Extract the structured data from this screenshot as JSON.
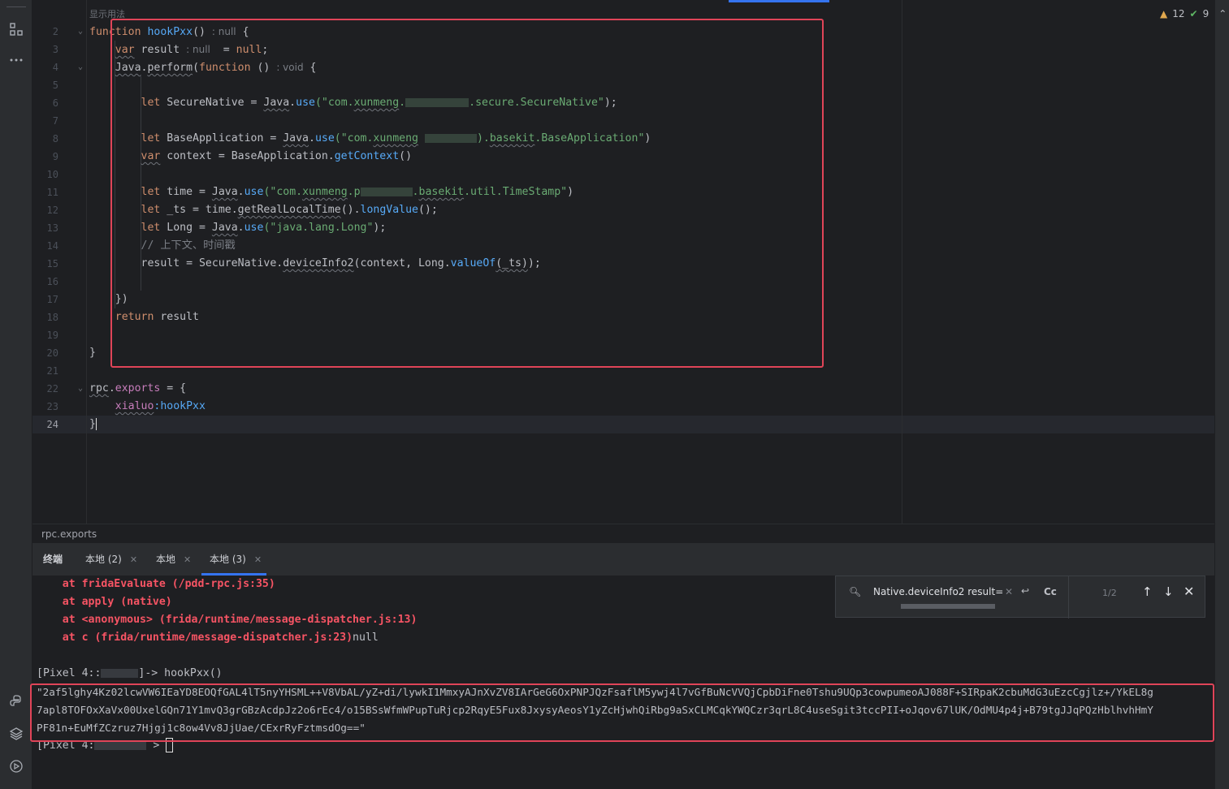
{
  "editor": {
    "hint_top": "显示用法",
    "inspections": {
      "warnings": "12",
      "ok": "9"
    },
    "line_numbers": [
      "2",
      "3",
      "4",
      "5",
      "6",
      "7",
      "8",
      "9",
      "10",
      "11",
      "12",
      "13",
      "14",
      "15",
      "16",
      "17",
      "18",
      "19",
      "20",
      "21",
      "22",
      "23",
      "24"
    ],
    "lines": {
      "l2": {
        "kw": "function",
        "name": "hookPxx",
        "punct": "()",
        "hint": ": null",
        "rest": " {"
      },
      "l3": {
        "kw": "var",
        "name": " result",
        "hint": ": null",
        "rest": "  = ",
        "null": "null",
        "end": ";"
      },
      "l4": {
        "obj": "Java",
        "dot": ".",
        "method": "perform",
        "open": "(",
        "kw": "function",
        "rest": " ()",
        "hint": ": void",
        "end": " {"
      },
      "l6": {
        "kw": "let",
        "rest": " SecureNative = ",
        "obj": "Java",
        "dot": ".",
        "method": "use",
        "str1": "(\"com.",
        "sq": "xunmeng",
        "str2": ".",
        "str3": ".secure.SecureNative\"",
        "end": ");"
      },
      "l8": {
        "kw": "let",
        "rest": " BaseApplication = ",
        "obj": "Java",
        "dot": ".",
        "method": "use",
        "str1": "(\"com.",
        "sq": "xunmeng",
        "str2": " ",
        "str3": ").",
        "sq2": "basekit",
        "str4": ".BaseApplication\"",
        "end": ")"
      },
      "l9": {
        "kw": "var",
        "rest": " context = BaseApplication.",
        "method": "getContext",
        "end": "()"
      },
      "l11": {
        "kw": "let",
        "rest": " time = ",
        "obj": "Java",
        "dot": ".",
        "method": "use",
        "str1": "(\"com.",
        "sq": "xunmeng",
        "str2": ".p",
        "str3": ".",
        "sq2": "basekit",
        "str4": ".util.TimeStamp\"",
        "end": ")"
      },
      "l12": {
        "kw": "let",
        "rest": " _ts = time.",
        "method": "getRealLocalTime",
        "mid": "().",
        "method2": "longValue",
        "end": "();"
      },
      "l13": {
        "kw": "let",
        "rest": " Long = ",
        "obj": "Java",
        "dot": ".",
        "method": "use",
        "str": "(\"java.lang.Long\"",
        "end": ");"
      },
      "l14": {
        "comment": "// 上下文、时间戳"
      },
      "l15": {
        "rest": "result = SecureNative.",
        "method": "deviceInfo2",
        "mid": "(context, Long.",
        "method2": "valueOf",
        "arg": "(_ts)",
        "end": ");"
      },
      "l17": {
        "text": "})"
      },
      "l18": {
        "kw": "return",
        "rest": " result"
      },
      "l20": {
        "text": "}"
      },
      "l22": {
        "obj": "rpc",
        "dot": ".",
        "prop": "exports",
        "rest": " = {"
      },
      "l23": {
        "key": "xialuo",
        "rest": ":hookPxx"
      },
      "l24": {
        "text": "}"
      }
    }
  },
  "breadcrumb": "rpc.exports",
  "tabs": [
    {
      "label": "终端"
    },
    {
      "label": "本地 (2)"
    },
    {
      "label": "本地"
    },
    {
      "label": "本地 (3)"
    }
  ],
  "find": {
    "query": "Native.deviceInfo2 result=",
    "case_label": "Cc",
    "count": "1/2"
  },
  "terminal": {
    "errors": [
      "at fridaEvaluate (/pdd-rpc.js:35)",
      "at apply (native)",
      "at <anonymous> (frida/runtime/message-dispatcher.js:13)",
      "at c (frida/runtime/message-dispatcher.js:23)"
    ],
    "null_text": "null",
    "prompt1_prefix": "[Pixel 4::",
    "prompt1_suffix": "]-> hookPxx()",
    "result": [
      "\"2af5lghy4Kz02lcwVW6IEaYD8EOQfGAL4lT5nyYHSML++V8VbAL/yZ+di/lywkI1MmxyAJnXvZV8IArGeG6OxPNPJQzFsaflM5ywj4l7vGfBuNcVVQjCpbDiFne0Tshu9UQp3cowpumeoAJ088F+SIRpaK2cbuMdG3uEzcCgjlz+/YkEL8g",
      "7apl8TOFOxXaVx00UxelGQn71Y1mvQ3grGBzAcdpJz2o6rEc4/o15BSsWfmWPupTuRjcp2RqyE5Fux8JxysyAeosY1yZcHjwhQiRbg9aSxCLMCqkYWQCzr3qrL8C4useSgit3tccPII+oJqov67lUK/OdMU4p4j+B79tgJJqPQzHblhvhHmY",
      "PF81n+EuMfZCzruz7Hjgj1c8ow4Vv8JjUae/CExrRyFztmsdOg==\""
    ],
    "prompt2_prefix": "[Pixel 4:",
    "prompt2_suffix": " >"
  },
  "colors": {
    "accent": "#3574f0",
    "highlight_box": "#e04458",
    "error": "#f75464"
  }
}
